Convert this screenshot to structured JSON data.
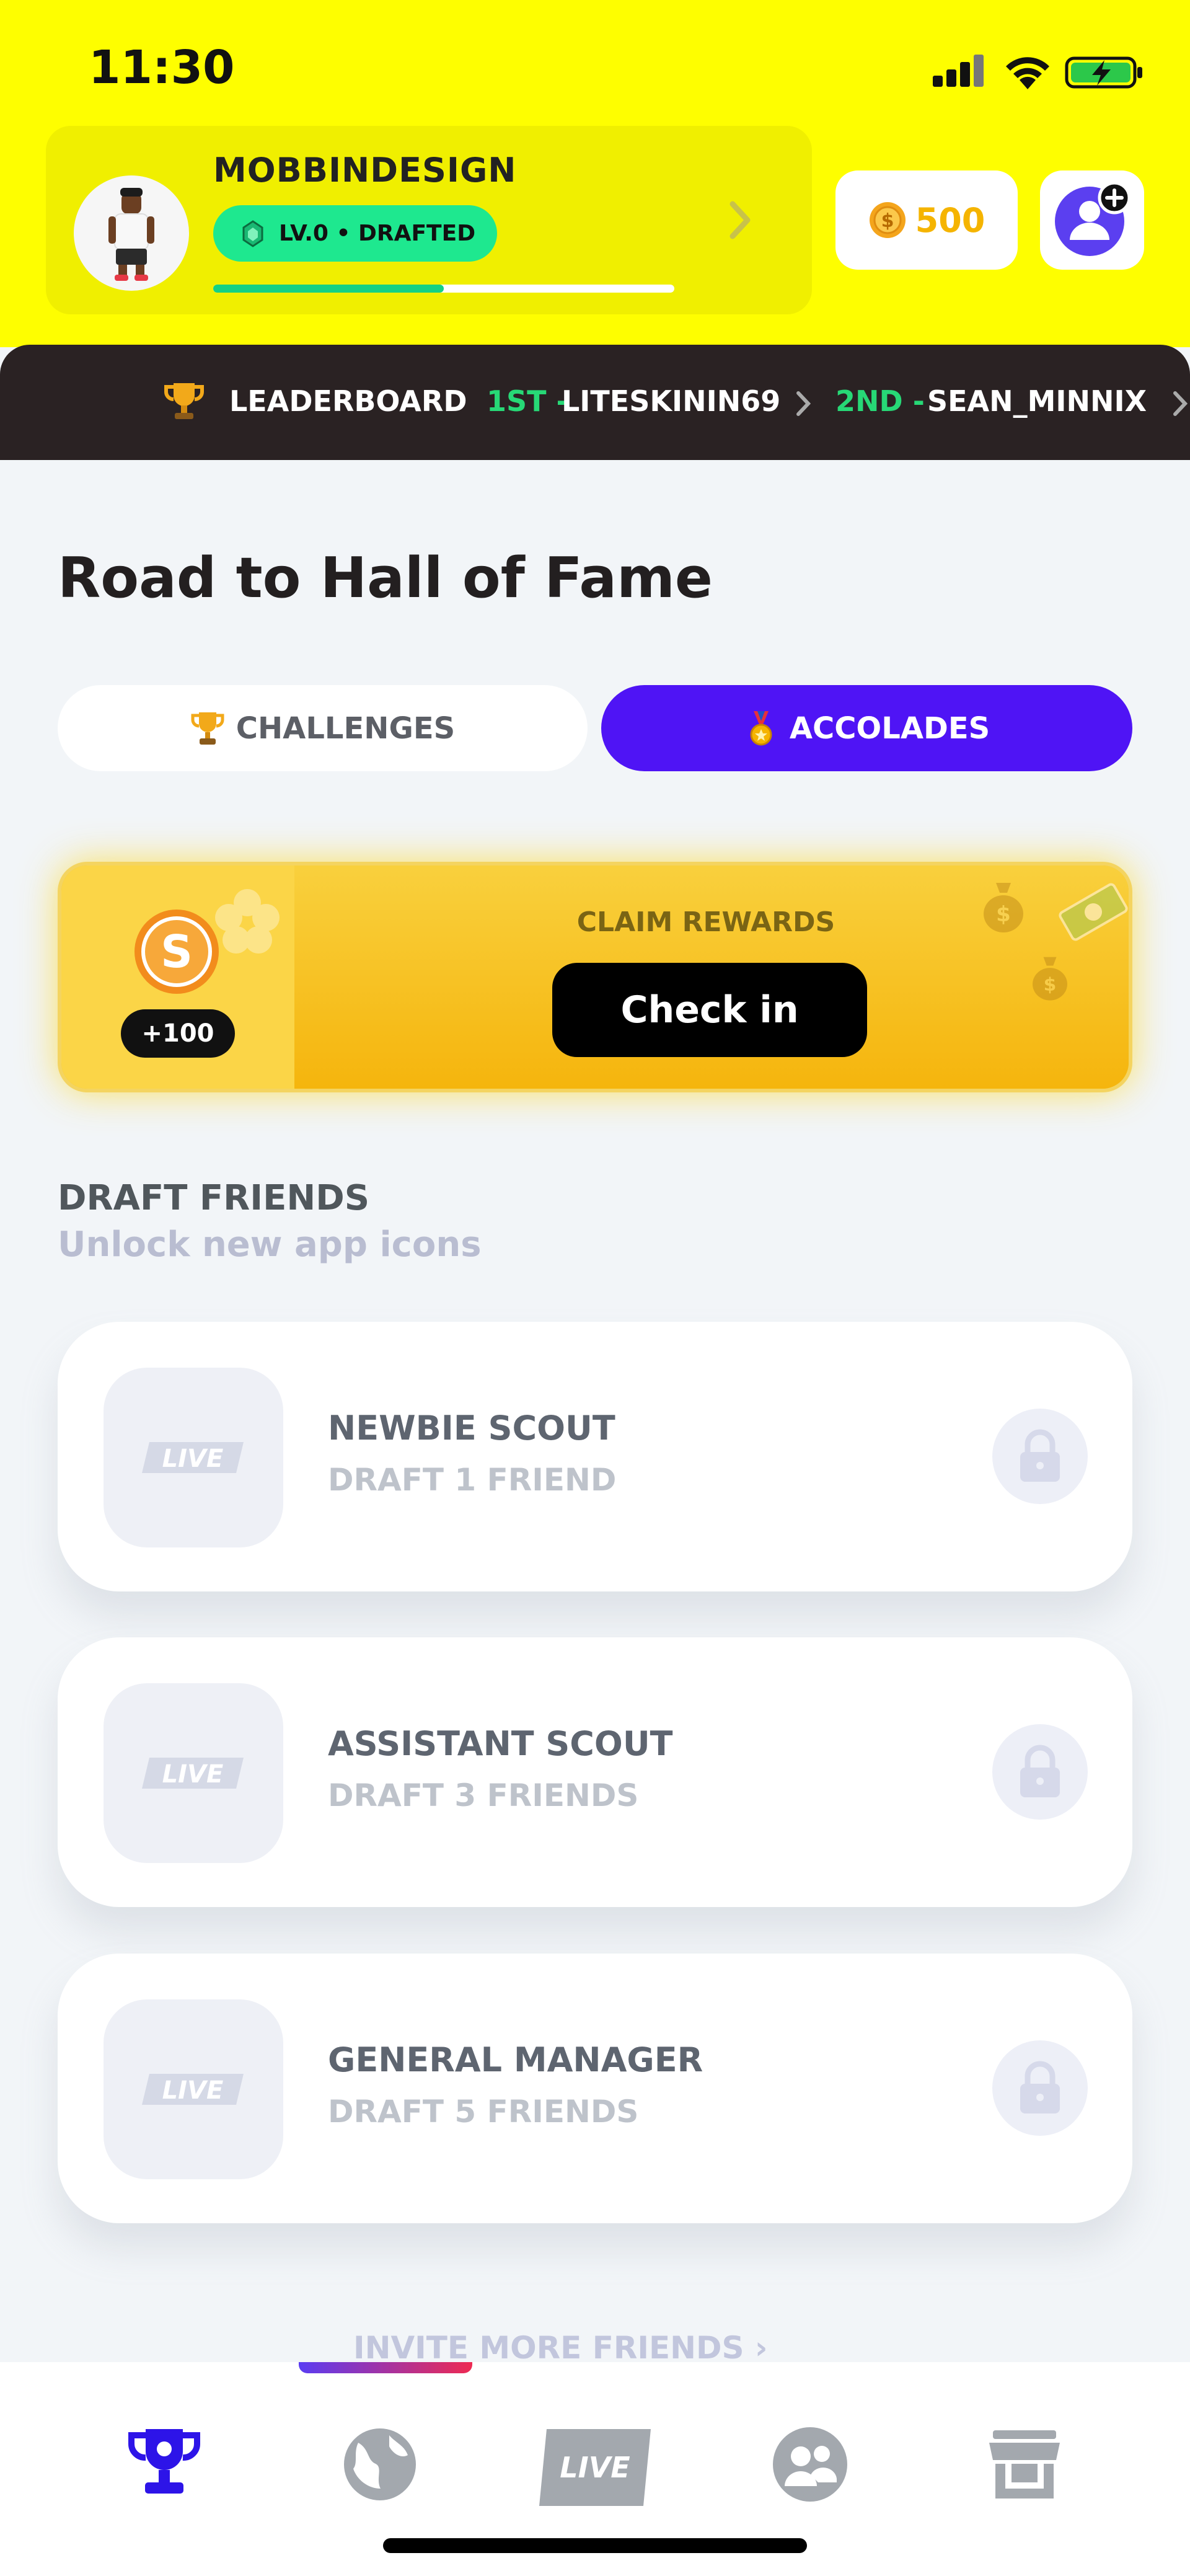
{
  "status_bar": {
    "time": "11:30"
  },
  "profile": {
    "username": "MOBBINDESIGN",
    "level_label": "LV.0 • DRAFTED",
    "xp_progress": 0.5
  },
  "wallet": {
    "coins": "500"
  },
  "leaderboard": {
    "label": "LEADERBOARD",
    "first_rank": "1ST -",
    "first_name": "LITESKININ69",
    "second_rank": "2ND -",
    "second_name": "SEAN_MINNIX"
  },
  "page": {
    "title": "Road to Hall of Fame"
  },
  "tabs": {
    "challenges": "CHALLENGES",
    "accolades": "ACCOLADES",
    "active": "accolades"
  },
  "claim": {
    "reward": "+100",
    "label": "CLAIM REWARDS",
    "button": "Check in"
  },
  "draft_friends": {
    "title": "DRAFT FRIENDS",
    "subtitle": "Unlock new app icons",
    "items": [
      {
        "name": "NEWBIE SCOUT",
        "requirement": "DRAFT 1 FRIEND",
        "icon_text": "LIVE",
        "locked": true
      },
      {
        "name": "ASSISTANT SCOUT",
        "requirement": "DRAFT 3 FRIENDS",
        "icon_text": "LIVE",
        "locked": true
      },
      {
        "name": "GENERAL MANAGER",
        "requirement": "DRAFT 5 FRIENDS",
        "icon_text": "LIVE",
        "locked": true
      }
    ],
    "invite_link": "INVITE MORE FRIENDS ›"
  },
  "tabbar": {
    "items": [
      "trophy-icon",
      "globe-icon",
      "live-icon",
      "friends-icon",
      "store-icon"
    ],
    "live_label": "LIVE",
    "active": "trophy-icon"
  },
  "colors": {
    "header_yellow": "#fefe00",
    "accent_purple": "#4f14f5",
    "level_green": "#1ee88f",
    "coin_gold": "#f5b400"
  }
}
